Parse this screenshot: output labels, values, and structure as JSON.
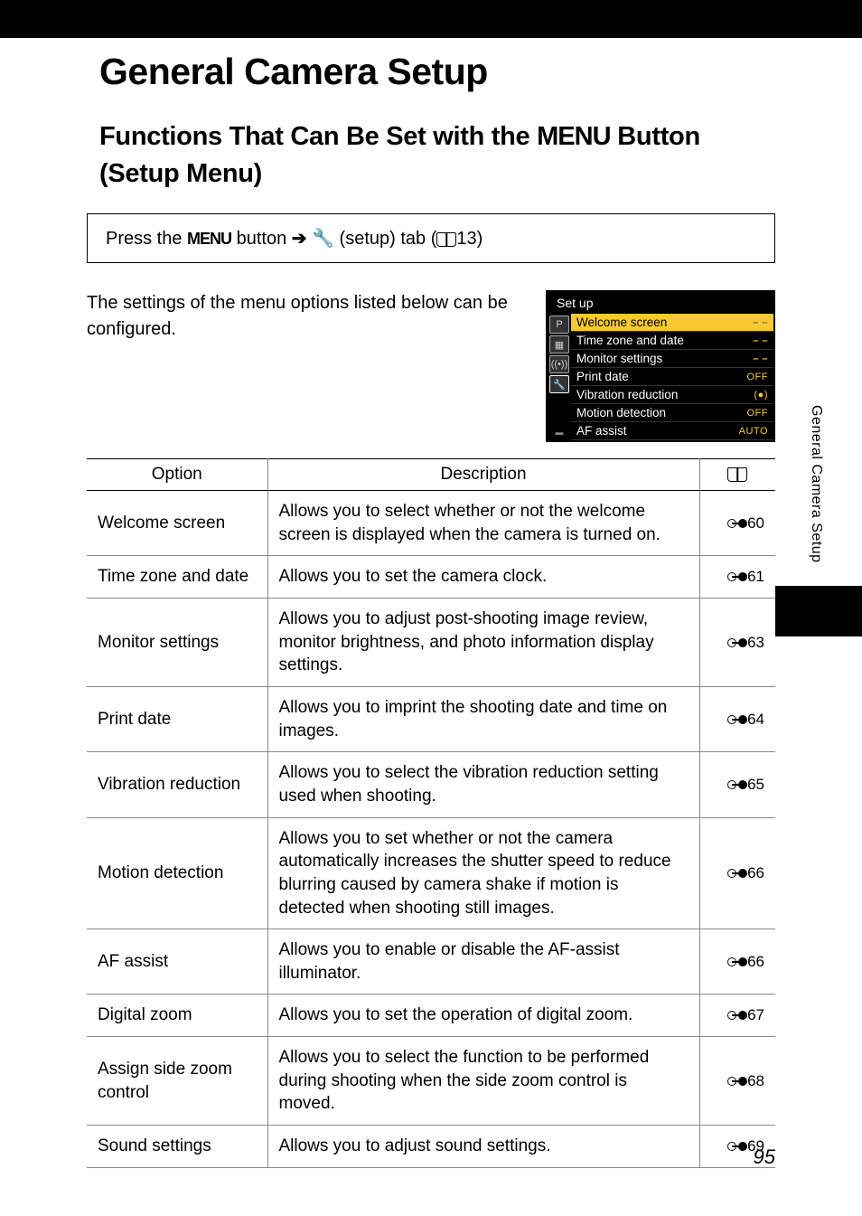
{
  "chapterTitle": "General Camera Setup",
  "sectionPrefix": "Functions That Can Be Set with the ",
  "sectionMenuWord": "MENU",
  "sectionSuffix": " Button (Setup Menu)",
  "instructionPrefix": "Press the ",
  "instructionMenuWord": "MENU",
  "instructionMid": " button ",
  "instructionAfterWrench": " (setup) tab (",
  "instructionPageRef": "13)",
  "introText": "The settings of the menu options listed below can be configured.",
  "screenshot": {
    "title": "Set up",
    "items": [
      {
        "label": "Welcome screen",
        "value": "– –",
        "highlight": true,
        "valClass": "dashes"
      },
      {
        "label": "Time zone and date",
        "value": "– –",
        "valClass": "dashes"
      },
      {
        "label": "Monitor settings",
        "value": "– –",
        "valClass": "dashes"
      },
      {
        "label": "Print date",
        "value": "OFF"
      },
      {
        "label": "Vibration reduction",
        "value": "(●)",
        "valClass": "vr-on"
      },
      {
        "label": "Motion detection",
        "value": "OFF"
      },
      {
        "label": "AF assist",
        "value": "AUTO"
      }
    ],
    "tabs": [
      "P",
      "▦",
      "((•))",
      "🔧"
    ]
  },
  "tableHeaders": {
    "option": "Option",
    "description": "Description"
  },
  "rows": [
    {
      "option": "Welcome screen",
      "description": "Allows you to select whether or not the welcome screen is displayed when the camera is turned on.",
      "ref": "60"
    },
    {
      "option": "Time zone and date",
      "description": "Allows you to set the camera clock.",
      "ref": "61"
    },
    {
      "option": "Monitor settings",
      "description": "Allows you to adjust post-shooting image review, monitor brightness, and photo information display settings.",
      "ref": "63"
    },
    {
      "option": "Print date",
      "description": "Allows you to imprint the shooting date and time on images.",
      "ref": "64"
    },
    {
      "option": "Vibration reduction",
      "description": "Allows you to select the vibration reduction setting used when shooting.",
      "ref": "65"
    },
    {
      "option": "Motion detection",
      "description": "Allows you to set whether or not the camera automatically increases the shutter speed to reduce blurring caused by camera shake if motion is detected when shooting still images.",
      "ref": "66"
    },
    {
      "option": "AF assist",
      "description": "Allows you to enable or disable the AF-assist illuminator.",
      "ref": "66"
    },
    {
      "option": "Digital zoom",
      "description": "Allows you to set the operation of digital zoom.",
      "ref": "67"
    },
    {
      "option": "Assign side zoom control",
      "description": "Allows you to select the function to be performed during shooting when the side zoom control is moved.",
      "ref": "68"
    },
    {
      "option": "Sound settings",
      "description": "Allows you to adjust sound settings.",
      "ref": "69"
    }
  ],
  "sideTabLabel": "General Camera Setup",
  "pageNumber": "95"
}
